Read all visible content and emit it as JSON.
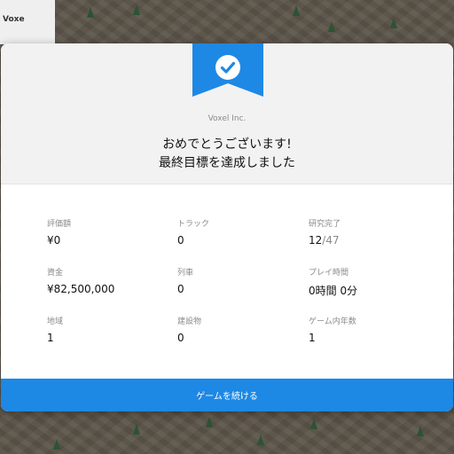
{
  "corner_panel": {
    "title": "Voxe"
  },
  "modal": {
    "company": "Voxel Inc.",
    "message_line1": "おめでとうございます!",
    "message_line2": "最終目標を達成しました",
    "icon": "check-circle-icon",
    "accent_color": "#1e88e5",
    "stats": {
      "valuation": {
        "label": "評価額",
        "value": "¥0"
      },
      "trucks": {
        "label": "トラック",
        "value": "0"
      },
      "research": {
        "label": "研究完了",
        "done": "12",
        "total": "/47"
      },
      "funds": {
        "label": "資金",
        "value": "¥82,500,000"
      },
      "trains": {
        "label": "列車",
        "value": "0"
      },
      "play_time": {
        "label": "プレイ時間",
        "value": "0時間 0分"
      },
      "regions": {
        "label": "地域",
        "value": "1"
      },
      "buildings": {
        "label": "建設物",
        "value": "0"
      },
      "game_years": {
        "label": "ゲーム内年数",
        "value": "1"
      }
    },
    "continue_label": "ゲームを続ける"
  }
}
